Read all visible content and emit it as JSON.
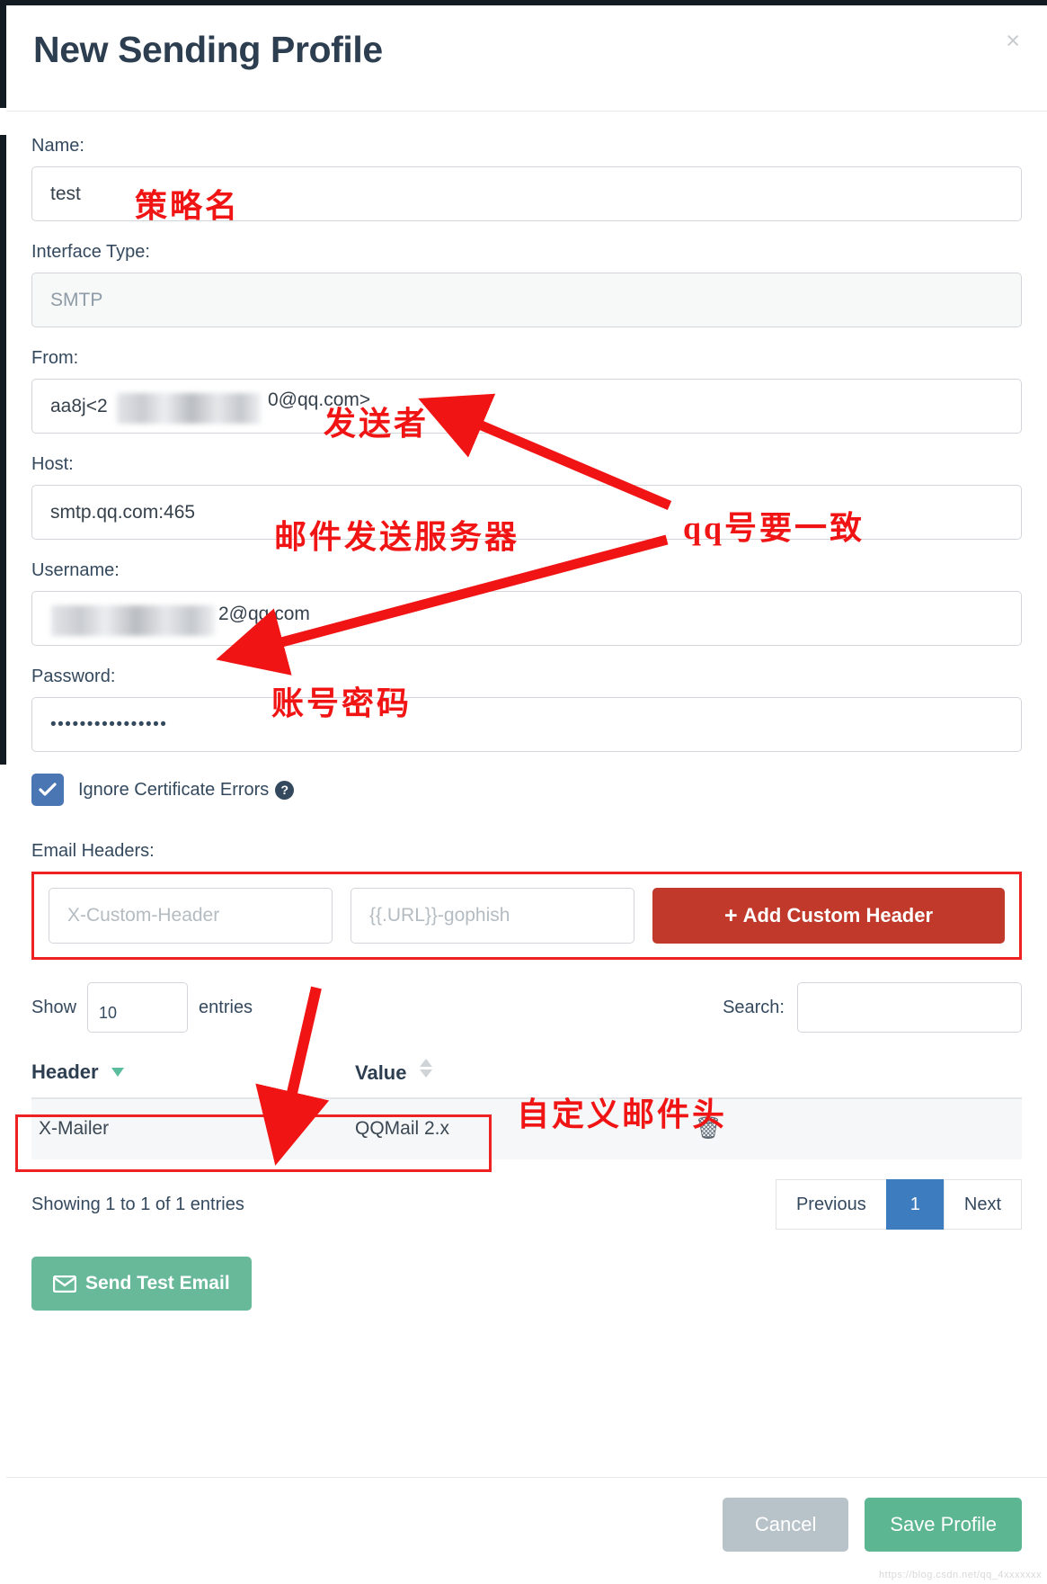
{
  "modal": {
    "title": "New Sending Profile",
    "close_label": "×"
  },
  "form": {
    "name_label": "Name:",
    "name_value": "test",
    "interface_label": "Interface Type:",
    "interface_value": "SMTP",
    "from_label": "From:",
    "from_value_prefix": "aa8j<2",
    "from_value_suffix": "0@qq.com>",
    "host_label": "Host:",
    "host_value": "smtp.qq.com:465",
    "username_label": "Username:",
    "username_value_suffix": "2@qq.com",
    "password_label": "Password:",
    "password_value": "••••••••••••••••",
    "ignore_cert_label": "Ignore Certificate Errors",
    "ignore_cert_checked": true,
    "help_glyph": "?"
  },
  "headers": {
    "section_label": "Email Headers:",
    "key_placeholder": "X-Custom-Header",
    "value_placeholder": "{{.URL}}-gophish",
    "add_button_label": "Add Custom Header",
    "add_button_icon": "plus-icon",
    "add_button_color": "#c0392b"
  },
  "table": {
    "show_label": "Show",
    "entries_label": "entries",
    "page_length": "10",
    "search_label": "Search:",
    "search_value": "",
    "columns": [
      "Header",
      "Value"
    ],
    "rows": [
      {
        "header": "X-Mailer",
        "value": "QQMail 2.x",
        "delete_icon": "trash-icon"
      }
    ],
    "info": "Showing 1 to 1 of 1 entries",
    "pagination": {
      "previous": "Previous",
      "pages": [
        "1"
      ],
      "next": "Next",
      "active_page": "1"
    }
  },
  "actions": {
    "send_test_label": "Send Test Email",
    "send_test_icon": "envelope-icon",
    "cancel_label": "Cancel",
    "save_label": "Save Profile"
  },
  "annotations": [
    {
      "text": "策略名"
    },
    {
      "text": "发送者"
    },
    {
      "text": "qq号要一致"
    },
    {
      "text": "邮件发送服务器"
    },
    {
      "text": "账号密码"
    },
    {
      "text": "自定义邮件头"
    }
  ],
  "watermark": "https://blog.csdn.net/qq_4xxxxxxx"
}
